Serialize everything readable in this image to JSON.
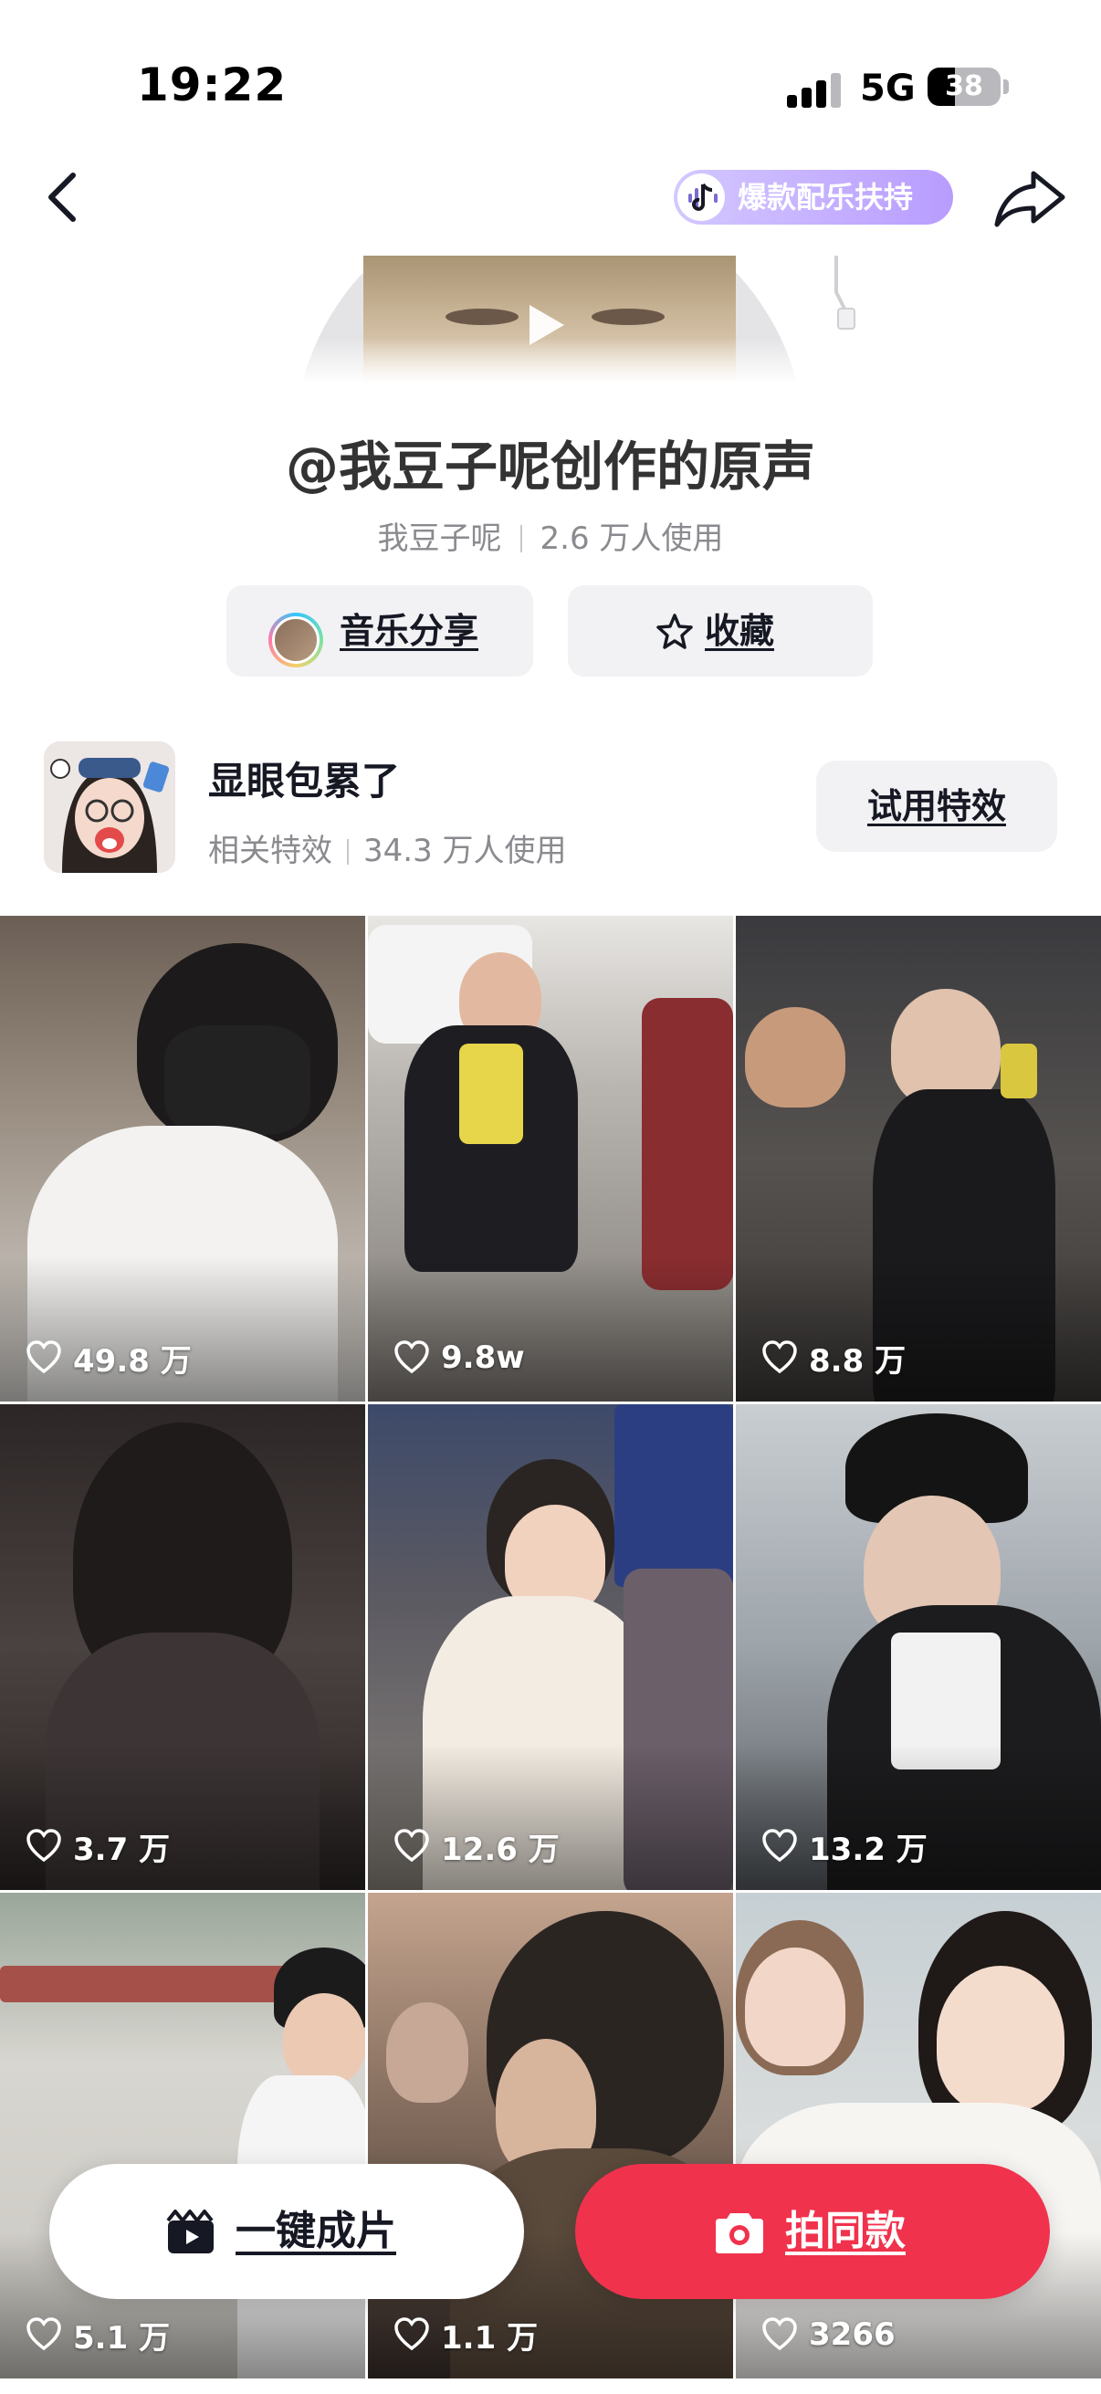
{
  "status_bar": {
    "time": "19:22",
    "network": "5G",
    "battery": "38",
    "battery_level": 0.38
  },
  "header": {
    "promo_label": "爆款配乐扶持"
  },
  "music": {
    "title": "@我豆子呢创作的原声",
    "author": "我豆子呢",
    "usage": "2.6 万人使用",
    "share_label": "音乐分享",
    "favorite_label": "收藏"
  },
  "effect": {
    "name": "显眼包累了",
    "tag": "相关特效",
    "usage": "34.3 万人使用",
    "try_label": "试用特效"
  },
  "videos": [
    {
      "likes": "49.8 万"
    },
    {
      "likes": "9.8w"
    },
    {
      "likes": "8.8 万"
    },
    {
      "likes": "3.7 万"
    },
    {
      "likes": "12.6 万"
    },
    {
      "likes": "13.2 万"
    },
    {
      "likes": "5.1 万"
    },
    {
      "likes": "1.1 万"
    },
    {
      "likes": "3266"
    }
  ],
  "bottom": {
    "oneclick_label": "一键成片",
    "shoot_label": "拍同款"
  },
  "colors": {
    "accent": "#f0324d",
    "promo": "#b89cff",
    "pill_bg": "#f2f2f4",
    "muted_text": "#8a8a8f"
  }
}
